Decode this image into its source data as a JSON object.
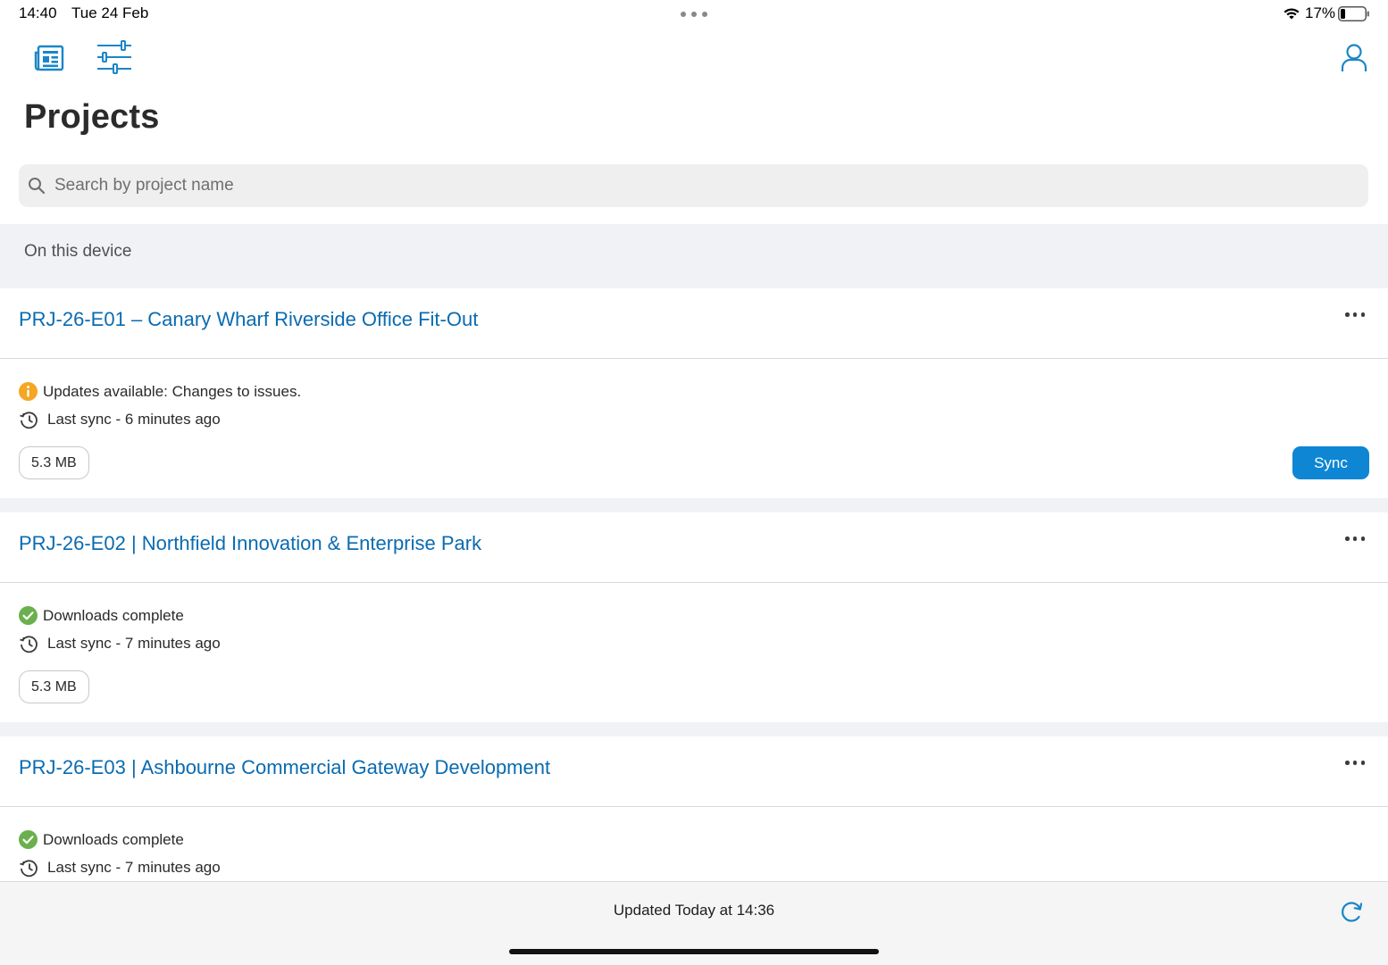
{
  "status_bar": {
    "time": "14:40",
    "date": "Tue 24 Feb",
    "battery_percent": "17%"
  },
  "toolbar": {
    "news_icon": "newspaper-icon",
    "filter_icon": "sliders-icon",
    "profile_icon": "person-icon"
  },
  "page": {
    "title": "Projects"
  },
  "search": {
    "placeholder": "Search by project name",
    "value": ""
  },
  "section": {
    "label": "On this device"
  },
  "projects": [
    {
      "title": "PRJ-26-E01 – Canary Wharf Riverside Office Fit-Out",
      "status": "Updates available: Changes to issues.",
      "status_type": "warning",
      "last_sync": "Last sync - 6 minutes ago",
      "size": "5.3 MB",
      "sync_label": "Sync"
    },
    {
      "title": "PRJ-26-E02 | Northfield Innovation & Enterprise Park",
      "status": "Downloads complete",
      "status_type": "success",
      "last_sync": "Last sync - 7 minutes ago",
      "size": "5.3 MB"
    },
    {
      "title": "PRJ-26-E03 | Ashbourne Commercial Gateway Development",
      "status": "Downloads complete",
      "status_type": "success",
      "last_sync": "Last sync - 7 minutes ago"
    }
  ],
  "footer": {
    "updated_text": "Updated Today at 14:36"
  },
  "colors": {
    "accent": "#0a6bb1",
    "button": "#0e86d4",
    "warning": "#f5a623",
    "success": "#6ab04c"
  }
}
